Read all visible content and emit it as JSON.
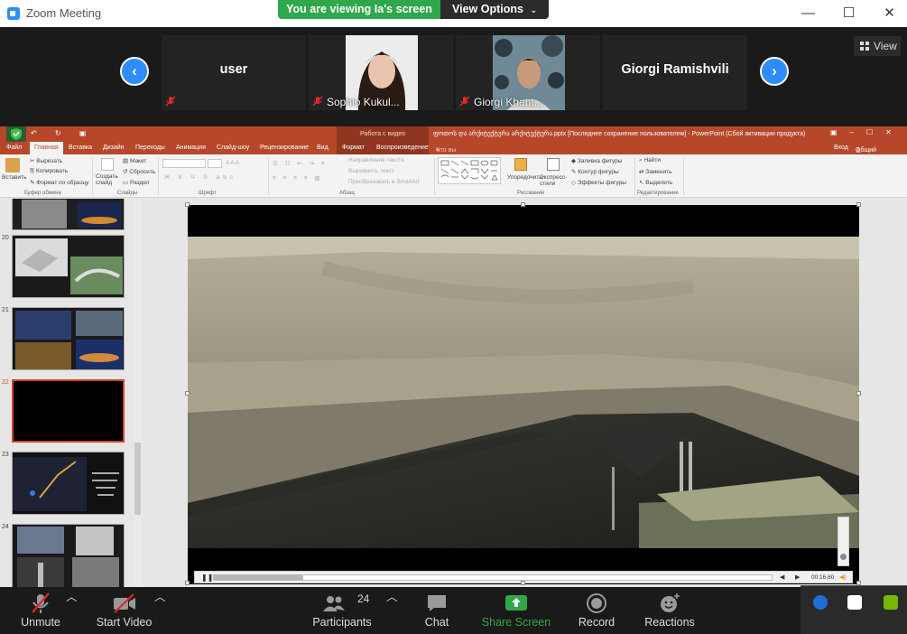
{
  "window": {
    "title": "Zoom Meeting",
    "viewing_banner": "You are viewing Ia's screen",
    "view_options": "View Options",
    "minimize": "—",
    "maximize": "☐",
    "close": "✕"
  },
  "strip": {
    "prev": "‹",
    "next": "›",
    "view_label": "View",
    "tiles": [
      {
        "name": "user",
        "video": false
      },
      {
        "name": "Sophio Kukul...",
        "video": true
      },
      {
        "name": "Giorgi Khant...",
        "video": true
      },
      {
        "name": "Giorgi Ramishvili",
        "video": false
      }
    ]
  },
  "ppt": {
    "context_tab": "Работа с видео",
    "doc_title": "ფოთოს და არქიტექტურა არქიტექტურა.pptx [Последнее сохранение пользователем] - PowerPoint (Сбой активации продукта)",
    "tabs": [
      "Файл",
      "Главная",
      "Вставка",
      "Дизайн",
      "Переходы",
      "Анимация",
      "Слайд-шоу",
      "Рецензирование",
      "Вид",
      "Формат",
      "Воспроизведение"
    ],
    "search_hint": "Что вы хотите сделать?",
    "signin": "Вход",
    "share": "Общий доступ",
    "ribbon": {
      "paste": "Вставить",
      "cut": "Вырезать",
      "copy": "Копировать",
      "format_painter": "Формат по образцу",
      "clipboard": "Буфер обмена",
      "new_slide": "Создать слайд",
      "layout": "Макет",
      "reset": "Сбросить",
      "section": "Раздел",
      "slides": "Слайды",
      "font": "Шрифт",
      "text_direction": "Направление текста",
      "align_text": "Выровнять текст",
      "smartart": "Преобразовать в SmartArt",
      "paragraph": "Абзац",
      "arrange": "Упорядочить",
      "quick_styles": "Экспресс-стили",
      "shape_fill": "Заливка фигуры",
      "shape_outline": "Контур фигуры",
      "shape_effects": "Эффекты фигуры",
      "drawing": "Рисование",
      "find": "Найти",
      "replace": "Заменить",
      "select": "Выделить",
      "editing": "Редактирование"
    },
    "slides": [
      {
        "num": "20"
      },
      {
        "num": "21"
      },
      {
        "num": "22"
      },
      {
        "num": "23"
      },
      {
        "num": "24"
      }
    ],
    "video_time": "00:16,60",
    "video_progress": 0.16
  },
  "toolbar": {
    "unmute": "Unmute",
    "start_video": "Start Video",
    "participants": "Participants",
    "participants_count": "24",
    "chat": "Chat",
    "share_screen": "Share Screen",
    "record": "Record",
    "reactions": "Reactions"
  },
  "colors": {
    "zoom_blue": "#2d8cff",
    "share_green": "#2ea84a",
    "ppt_red": "#b7472a",
    "mute_red": "#e02828"
  }
}
